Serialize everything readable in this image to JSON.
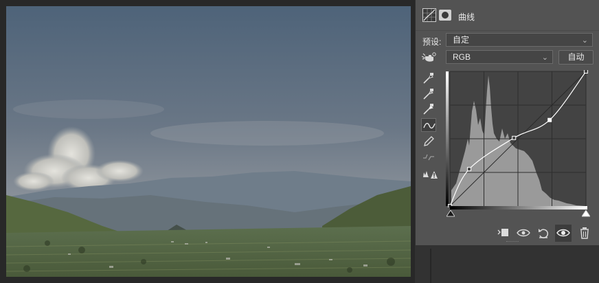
{
  "panel": {
    "title": "曲线",
    "preset_label": "预设:",
    "preset_value": "自定",
    "channel_value": "RGB",
    "auto_button": "自动"
  },
  "tools": [
    {
      "name": "sample-black-point-icon"
    },
    {
      "name": "sample-gray-point-icon"
    },
    {
      "name": "sample-white-point-icon"
    },
    {
      "name": "curve-point-tool-icon"
    },
    {
      "name": "pencil-draw-icon"
    },
    {
      "name": "smooth-curve-icon"
    },
    {
      "name": "clipping-warning-icon"
    }
  ],
  "curve": {
    "channel": "RGB",
    "input_range": [
      0,
      255
    ],
    "output_range": [
      0,
      255
    ],
    "points": [
      [
        0,
        0
      ],
      [
        36,
        70
      ],
      [
        120,
        129
      ],
      [
        187,
        163
      ],
      [
        255,
        255
      ]
    ]
  },
  "bottom_toolbar": [
    "clip-to-layer-icon",
    "view-previous-state-icon",
    "reset-icon",
    "toggle-visibility-icon",
    "delete-icon"
  ]
}
